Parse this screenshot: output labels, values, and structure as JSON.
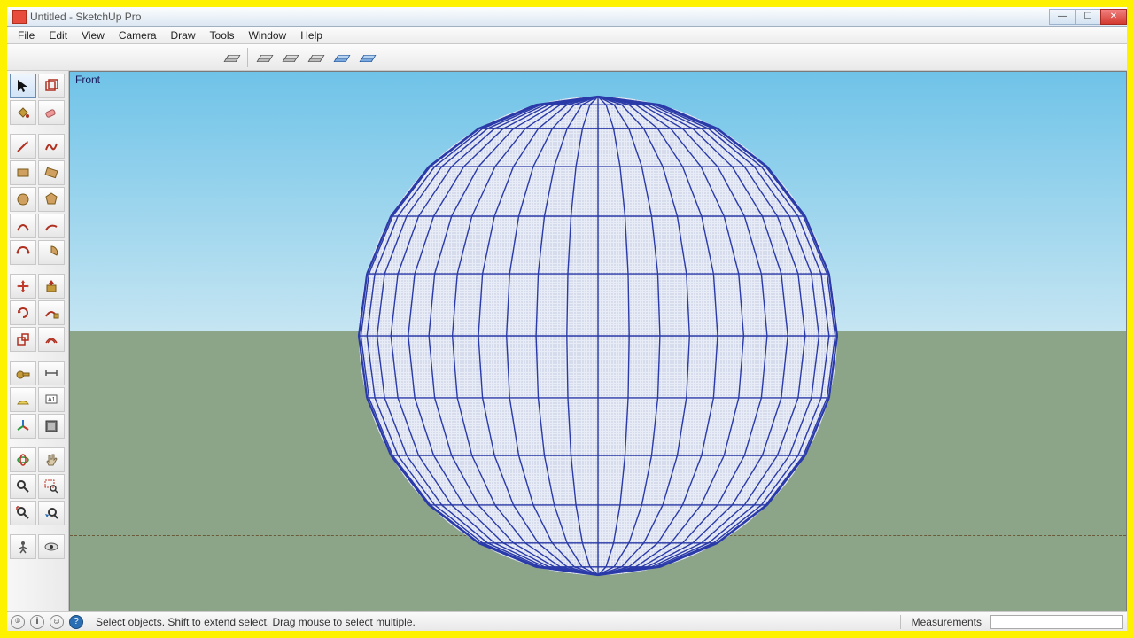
{
  "window": {
    "title": "Untitled - SketchUp Pro"
  },
  "menu": {
    "items": [
      "File",
      "Edit",
      "View",
      "Camera",
      "Draw",
      "Tools",
      "Window",
      "Help"
    ]
  },
  "viewport": {
    "label": "Front"
  },
  "status": {
    "hint": "Select objects. Shift to extend select. Drag mouse to select multiple.",
    "measurements_label": "Measurements",
    "measurements_value": ""
  },
  "toolbar2": {
    "buttons": [
      "layers-single",
      "layers-tray",
      "layers-multi",
      "layers-stack",
      "layers-blue-a",
      "layers-blue-b"
    ]
  },
  "tools": {
    "rows": [
      [
        "select",
        "component"
      ],
      [
        "paint",
        "eraser"
      ],
      [],
      [
        "line",
        "freehand"
      ],
      [
        "rectangle",
        "rot-rectangle"
      ],
      [
        "circle",
        "polygon"
      ],
      [
        "arc",
        "arc2pt"
      ],
      [
        "arc3pt",
        "pie"
      ],
      [],
      [
        "move",
        "pushpull"
      ],
      [
        "rotate",
        "followme"
      ],
      [
        "scale",
        "offset"
      ],
      [],
      [
        "tape",
        "protractor-tool"
      ],
      [
        "protractor",
        "text"
      ],
      [
        "axes",
        "dimension"
      ],
      [],
      [
        "orbit",
        "pan"
      ],
      [
        "zoom",
        "zoom-window"
      ],
      [
        "zoom-extents",
        "previous"
      ],
      [],
      [
        "position-camera",
        "look-around"
      ]
    ],
    "selected": "select"
  }
}
